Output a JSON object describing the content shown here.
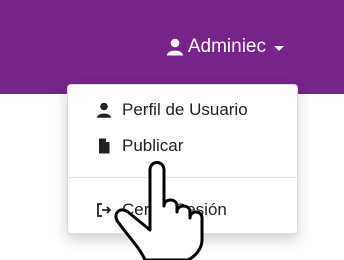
{
  "navbar": {
    "user_label": "Adminiec",
    "accent_color": "#76238a",
    "user_icon": "user-icon",
    "caret_icon": "caret-down-icon"
  },
  "dropdown": {
    "items": [
      {
        "label": "Perfil de Usuario",
        "icon": "user-icon"
      },
      {
        "label": "Publicar",
        "icon": "file-icon"
      },
      {
        "label": "Cerrar Sesión",
        "icon": "sign-out-icon"
      }
    ]
  },
  "cursor": {
    "icon": "hand-pointer-icon"
  }
}
